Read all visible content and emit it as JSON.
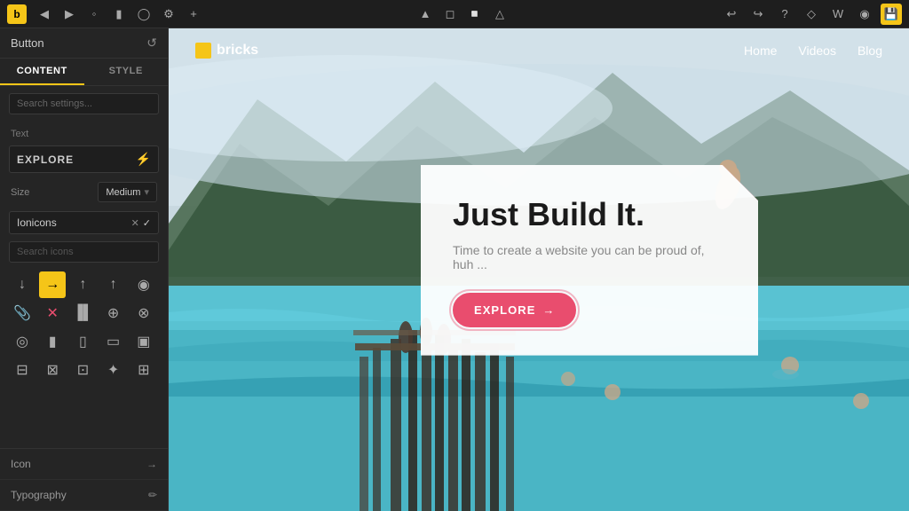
{
  "toolbar": {
    "logo": "b",
    "left_buttons": [
      "←",
      "→",
      "⬡",
      "▬",
      "◷",
      "⚙",
      "+"
    ],
    "right_buttons": [
      "↩",
      "↪",
      "?",
      "⬡",
      "♪",
      "◉",
      "💾"
    ],
    "device_buttons": [
      "🖥",
      "📱",
      "⊞",
      "📱"
    ]
  },
  "panel": {
    "title": "Button",
    "refresh_icon": "↺",
    "tabs": [
      {
        "label": "CONTENT",
        "active": true
      },
      {
        "label": "STYLE",
        "active": false
      }
    ],
    "search_placeholder": "Search settings...",
    "text_section_label": "Text",
    "text_value": "EXPLORE",
    "lightning_icon": "⚡",
    "size_label": "Size",
    "size_value": "Medium",
    "icon_library": "Ionicons",
    "icon_search_placeholder": "Search icons",
    "icons": [
      "↓",
      "→",
      "↑",
      "↑",
      "◎",
      "📎",
      "✖",
      "▐|▌",
      "⊕",
      "🛍",
      "⊗",
      "🔋",
      "🔒",
      "🚲",
      "✦",
      "🏠"
    ],
    "selected_icon_index": 1,
    "footer_items": [
      {
        "label": "Icon",
        "arrow": "→"
      },
      {
        "label": "Typography",
        "icon": "✏"
      }
    ]
  },
  "website": {
    "nav": {
      "logo_icon": "■",
      "logo_text": "bricks",
      "links": [
        "Home",
        "Videos",
        "Blog"
      ]
    },
    "hero": {
      "title": "Just Build It.",
      "subtitle": "Time to create a website you can be proud of, huh ...",
      "button_label": "EXPLORE",
      "button_arrow": "→"
    }
  }
}
